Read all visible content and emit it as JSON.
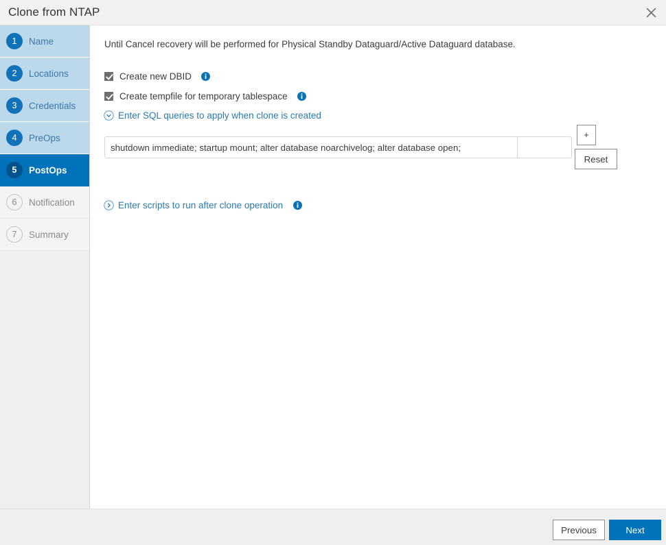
{
  "window": {
    "title": "Clone from NTAP",
    "close_icon": "close-icon"
  },
  "sidebar": {
    "items": [
      {
        "num": "1",
        "label": "Name",
        "state": "done"
      },
      {
        "num": "2",
        "label": "Locations",
        "state": "done"
      },
      {
        "num": "3",
        "label": "Credentials",
        "state": "done"
      },
      {
        "num": "4",
        "label": "PreOps",
        "state": "done"
      },
      {
        "num": "5",
        "label": "PostOps",
        "state": "active"
      },
      {
        "num": "6",
        "label": "Notification",
        "state": "todo"
      },
      {
        "num": "7",
        "label": "Summary",
        "state": "todo"
      }
    ]
  },
  "content": {
    "intro": "Until Cancel recovery will be performed for Physical Standby Dataguard/Active Dataguard database.",
    "checkboxes": [
      {
        "label": "Create new DBID",
        "checked": true,
        "info_icon": "info-icon"
      },
      {
        "label": "Create tempfile for temporary tablespace",
        "checked": true,
        "info_icon": "info-icon"
      }
    ],
    "sql_section": {
      "icon": "chevron-down-circle-icon",
      "label": "Enter SQL queries to apply when clone is created",
      "query_value": "shutdown immediate; startup mount; alter database noarchivelog; alter database open;",
      "query_placeholder": "",
      "extra_value": "",
      "extra_placeholder": "",
      "add_label": "+",
      "reset_label": "Reset"
    },
    "scripts_section": {
      "icon": "chevron-right-circle-icon",
      "label": "Enter scripts to run after clone operation",
      "info_icon": "info-icon"
    }
  },
  "footer": {
    "previous_label": "Previous",
    "next_label": "Next"
  },
  "colors": {
    "accent": "#0072bc",
    "step_done_bg": "#bcd9ec",
    "step_done_circle": "#1172ba",
    "active_circle": "#00528c",
    "link": "#2a7ab0",
    "chrome": "#efefef",
    "titlebar": "#f2f2f2"
  }
}
